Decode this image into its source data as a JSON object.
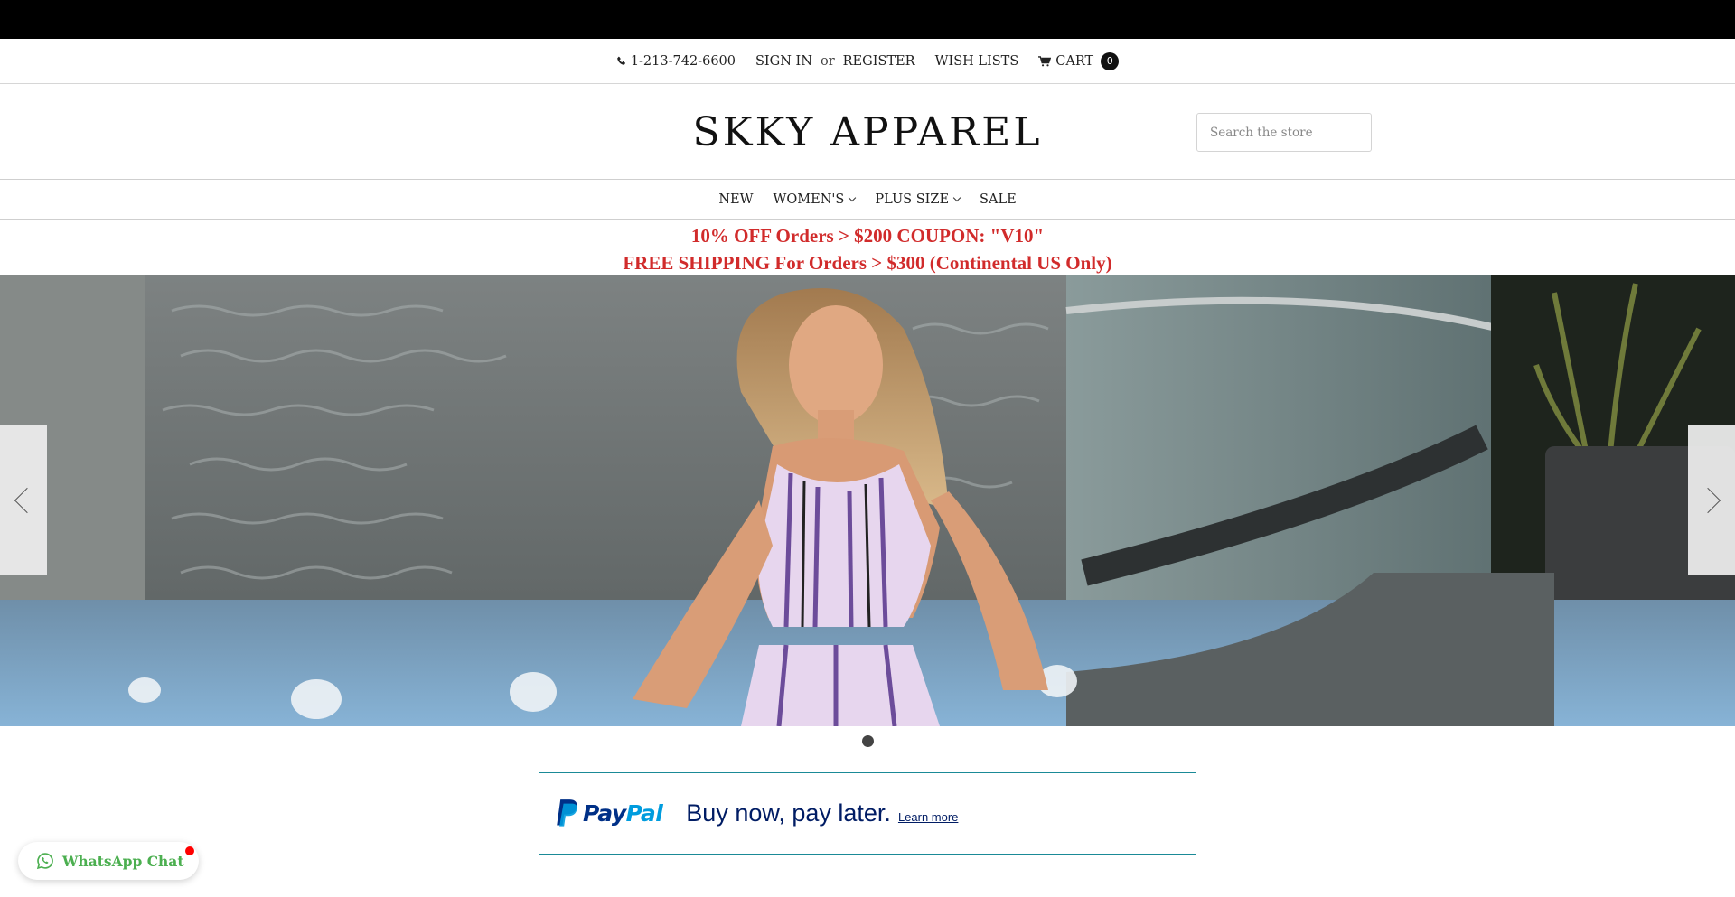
{
  "utility": {
    "phone": "1-213-742-6600",
    "sign_in": "SIGN IN",
    "or": "or",
    "register": "REGISTER",
    "wish_lists": "WISH LISTS",
    "cart_label": "CART",
    "cart_count": "0"
  },
  "header": {
    "logo": "SKKY APPAREL",
    "search_placeholder": "Search the store"
  },
  "nav": {
    "items": [
      {
        "label": "NEW"
      },
      {
        "label": "WOMEN'S"
      },
      {
        "label": "PLUS SIZE"
      },
      {
        "label": "SALE"
      }
    ]
  },
  "promo": {
    "line1": "10% OFF Orders > $200 COUPON: \"V10\"",
    "line2": "FREE SHIPPING For Orders > $300 (Continental US Only)"
  },
  "paypal": {
    "brand_pay": "Pay",
    "brand_pal": "Pal",
    "message": "Buy now, pay later.",
    "learn_more": "Learn more"
  },
  "whatsapp": {
    "label": "WhatsApp Chat"
  },
  "colors": {
    "promo_red": "#d12b2b",
    "paypal_navy": "#003087",
    "paypal_blue": "#009cde",
    "paypal_border": "#1a8a97",
    "whatsapp_green": "#4caf50"
  }
}
